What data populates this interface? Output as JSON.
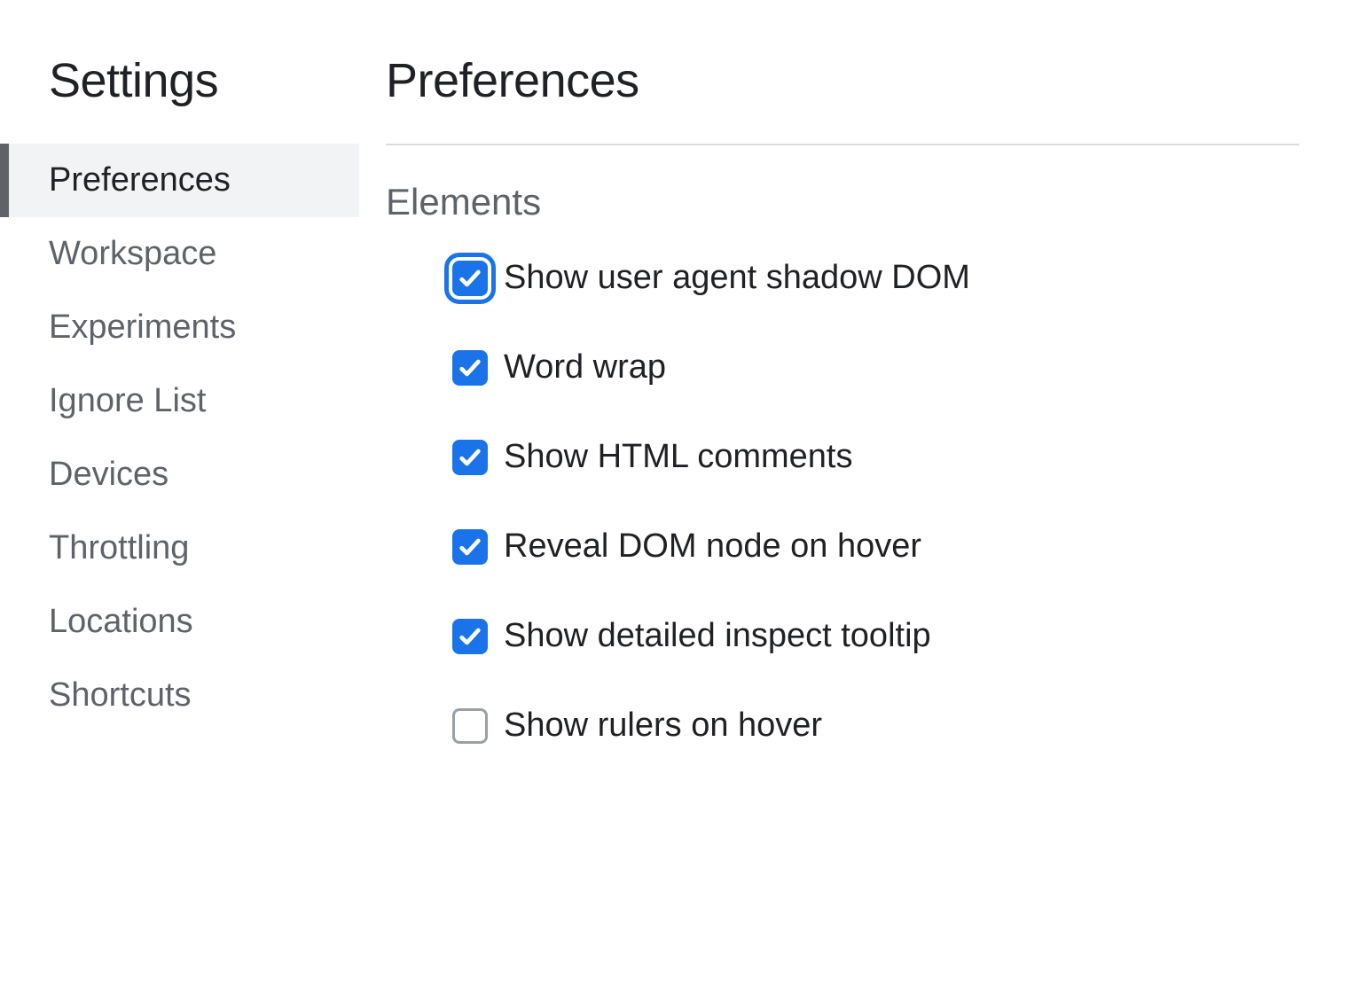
{
  "sidebar": {
    "title": "Settings",
    "items": [
      {
        "label": "Preferences",
        "active": true
      },
      {
        "label": "Workspace",
        "active": false
      },
      {
        "label": "Experiments",
        "active": false
      },
      {
        "label": "Ignore List",
        "active": false
      },
      {
        "label": "Devices",
        "active": false
      },
      {
        "label": "Throttling",
        "active": false
      },
      {
        "label": "Locations",
        "active": false
      },
      {
        "label": "Shortcuts",
        "active": false
      }
    ]
  },
  "main": {
    "title": "Preferences",
    "section": {
      "title": "Elements",
      "options": [
        {
          "label": "Show user agent shadow DOM",
          "checked": true,
          "focused": true
        },
        {
          "label": "Word wrap",
          "checked": true,
          "focused": false
        },
        {
          "label": "Show HTML comments",
          "checked": true,
          "focused": false
        },
        {
          "label": "Reveal DOM node on hover",
          "checked": true,
          "focused": false
        },
        {
          "label": "Show detailed inspect tooltip",
          "checked": true,
          "focused": false
        },
        {
          "label": "Show rulers on hover",
          "checked": false,
          "focused": false
        }
      ]
    }
  }
}
